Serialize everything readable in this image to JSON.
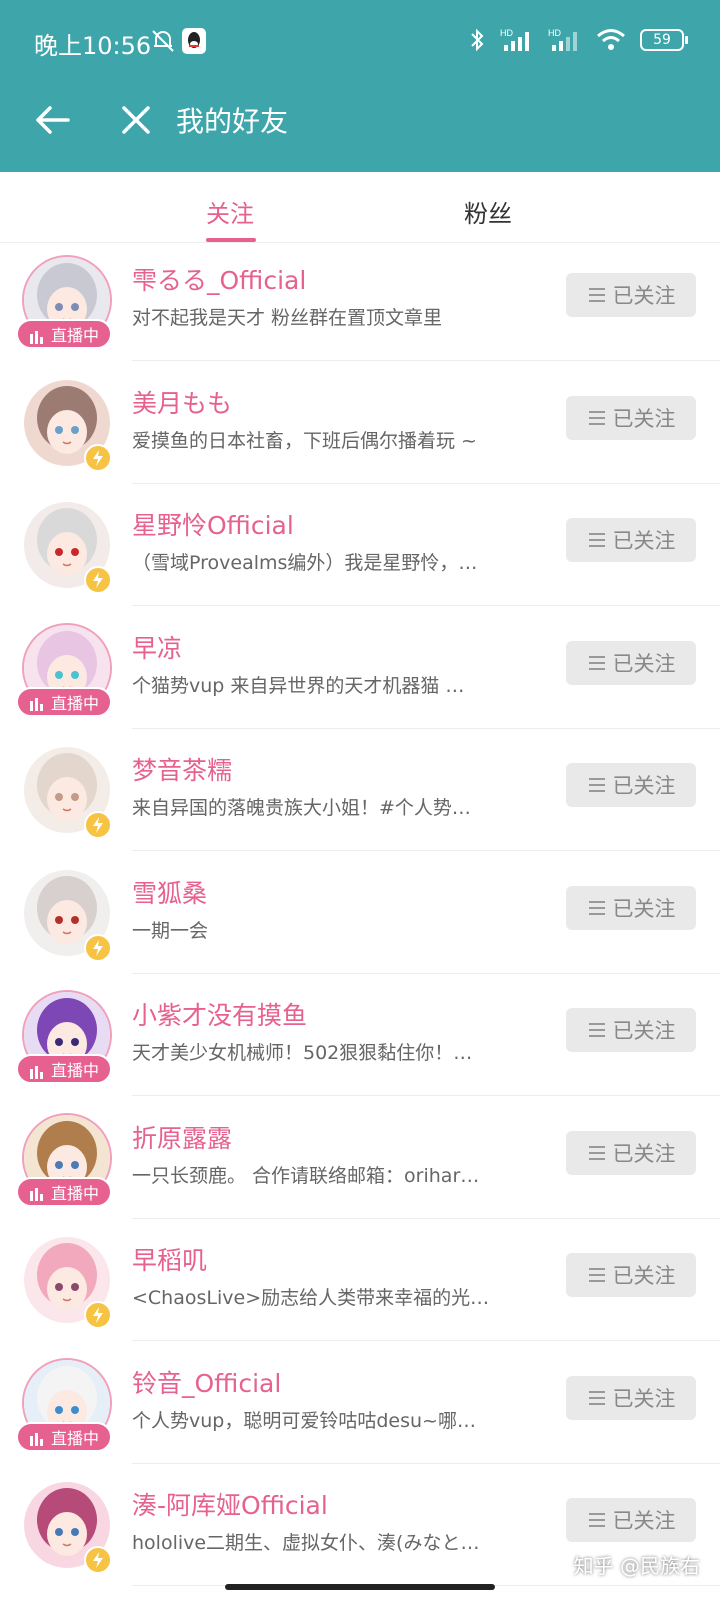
{
  "status_bar": {
    "time": "晚上10:56",
    "battery": "59"
  },
  "header": {
    "title": "我的好友"
  },
  "tabs": [
    {
      "label": "关注"
    },
    {
      "label": "粉丝"
    }
  ],
  "live_badge_label": "直播中",
  "follow_button_label": "已关注",
  "watermark": "知乎 @民族右",
  "friends": [
    {
      "name": "雫るる_Official",
      "bio": "对不起我是天才 粉丝群在置顶文章里",
      "live": true
    },
    {
      "name": "美月もも",
      "bio": "爱摸鱼的日本社畜，下班后偶尔播着玩 ~",
      "live": false
    },
    {
      "name": "星野怜Official",
      "bio": "（雪域Provealms编外）我是星野怜，…",
      "live": false
    },
    {
      "name": "早凉",
      "bio": "个猫势vup 来自异世界的天才机器猫 …",
      "live": true
    },
    {
      "name": "梦音茶糯",
      "bio": "来自异国的落魄贵族大小姐！#个人势…",
      "live": false
    },
    {
      "name": "雪狐桑",
      "bio": "一期一会",
      "live": false
    },
    {
      "name": "小紫才没有摸鱼",
      "bio": "天才美少女机械师！502狠狠黏住你！…",
      "live": true
    },
    {
      "name": "折原露露",
      "bio": "一只长颈鹿。 合作请联络邮箱：orihar…",
      "live": true
    },
    {
      "name": "早稻叽",
      "bio": "<ChaosLive>励志给人类带来幸福的光…",
      "live": false
    },
    {
      "name": "铃音_Official",
      "bio": "个人势vup，聪明可爱铃咕咕desu~哪…",
      "live": true
    },
    {
      "name": "湊-阿库娅Official",
      "bio": "hololive二期生、虚拟女仆、湊(みなと…",
      "live": false
    }
  ],
  "colors": {
    "accent": "#e6618f",
    "header": "#3ea6ab",
    "verified": "#f6c342"
  }
}
